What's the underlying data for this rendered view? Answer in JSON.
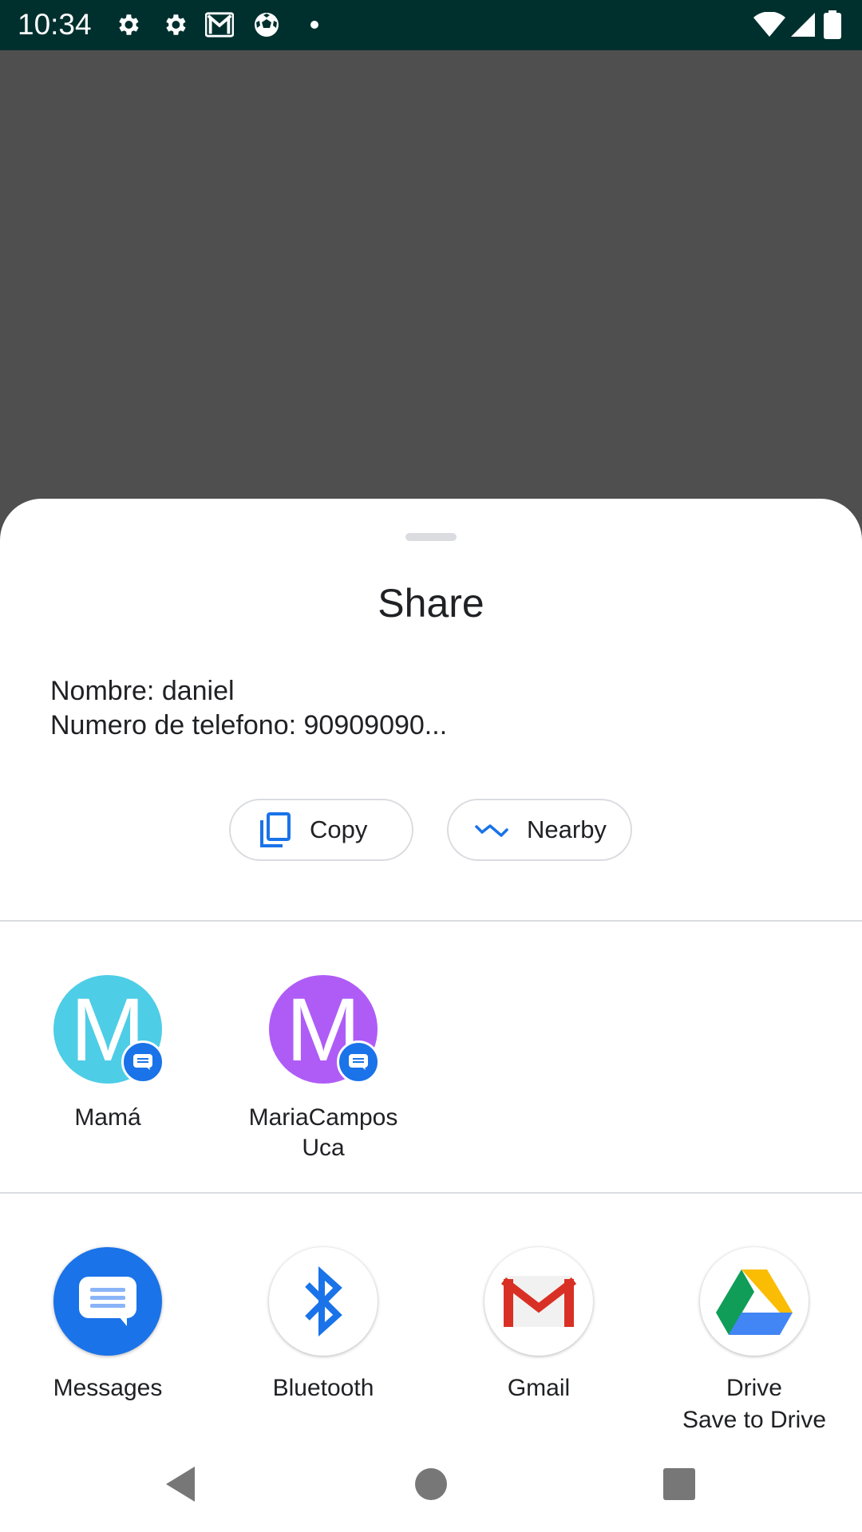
{
  "status_bar": {
    "time": "10:34",
    "left_icons": [
      "settings-icon",
      "settings-icon",
      "gmail-icon",
      "soccer-ball-icon",
      "dot-icon"
    ],
    "right_icons": [
      "wifi-icon",
      "signal-icon",
      "battery-icon"
    ]
  },
  "share_sheet": {
    "title": "Share",
    "content_line1": "Nombre: daniel",
    "content_line2": "Numero de telefono: 90909090...",
    "actions": [
      {
        "label": "Copy",
        "icon": "copy-icon"
      },
      {
        "label": "Nearby",
        "icon": "nearby-share-icon"
      }
    ],
    "contacts": [
      {
        "initial": "M",
        "name_line1": "Mamá",
        "name_line2": "",
        "color": "#4ecde6"
      },
      {
        "initial": "M",
        "name_line1": "MariaCampos",
        "name_line2": "Uca",
        "color": "#af5cf7"
      }
    ],
    "apps": [
      {
        "name": "Messages",
        "subtitle": "",
        "icon": "messages-icon"
      },
      {
        "name": "Bluetooth",
        "subtitle": "",
        "icon": "bluetooth-icon"
      },
      {
        "name": "Gmail",
        "subtitle": "",
        "icon": "gmail-icon"
      },
      {
        "name": "Drive",
        "subtitle": "Save to Drive",
        "icon": "drive-icon"
      }
    ]
  },
  "nav_bar": {
    "buttons": [
      "back-icon",
      "home-icon",
      "recents-icon"
    ]
  },
  "colors": {
    "status_bar": "#00302e",
    "scrim": "#4f4f4f",
    "accent": "#1a73e8"
  }
}
